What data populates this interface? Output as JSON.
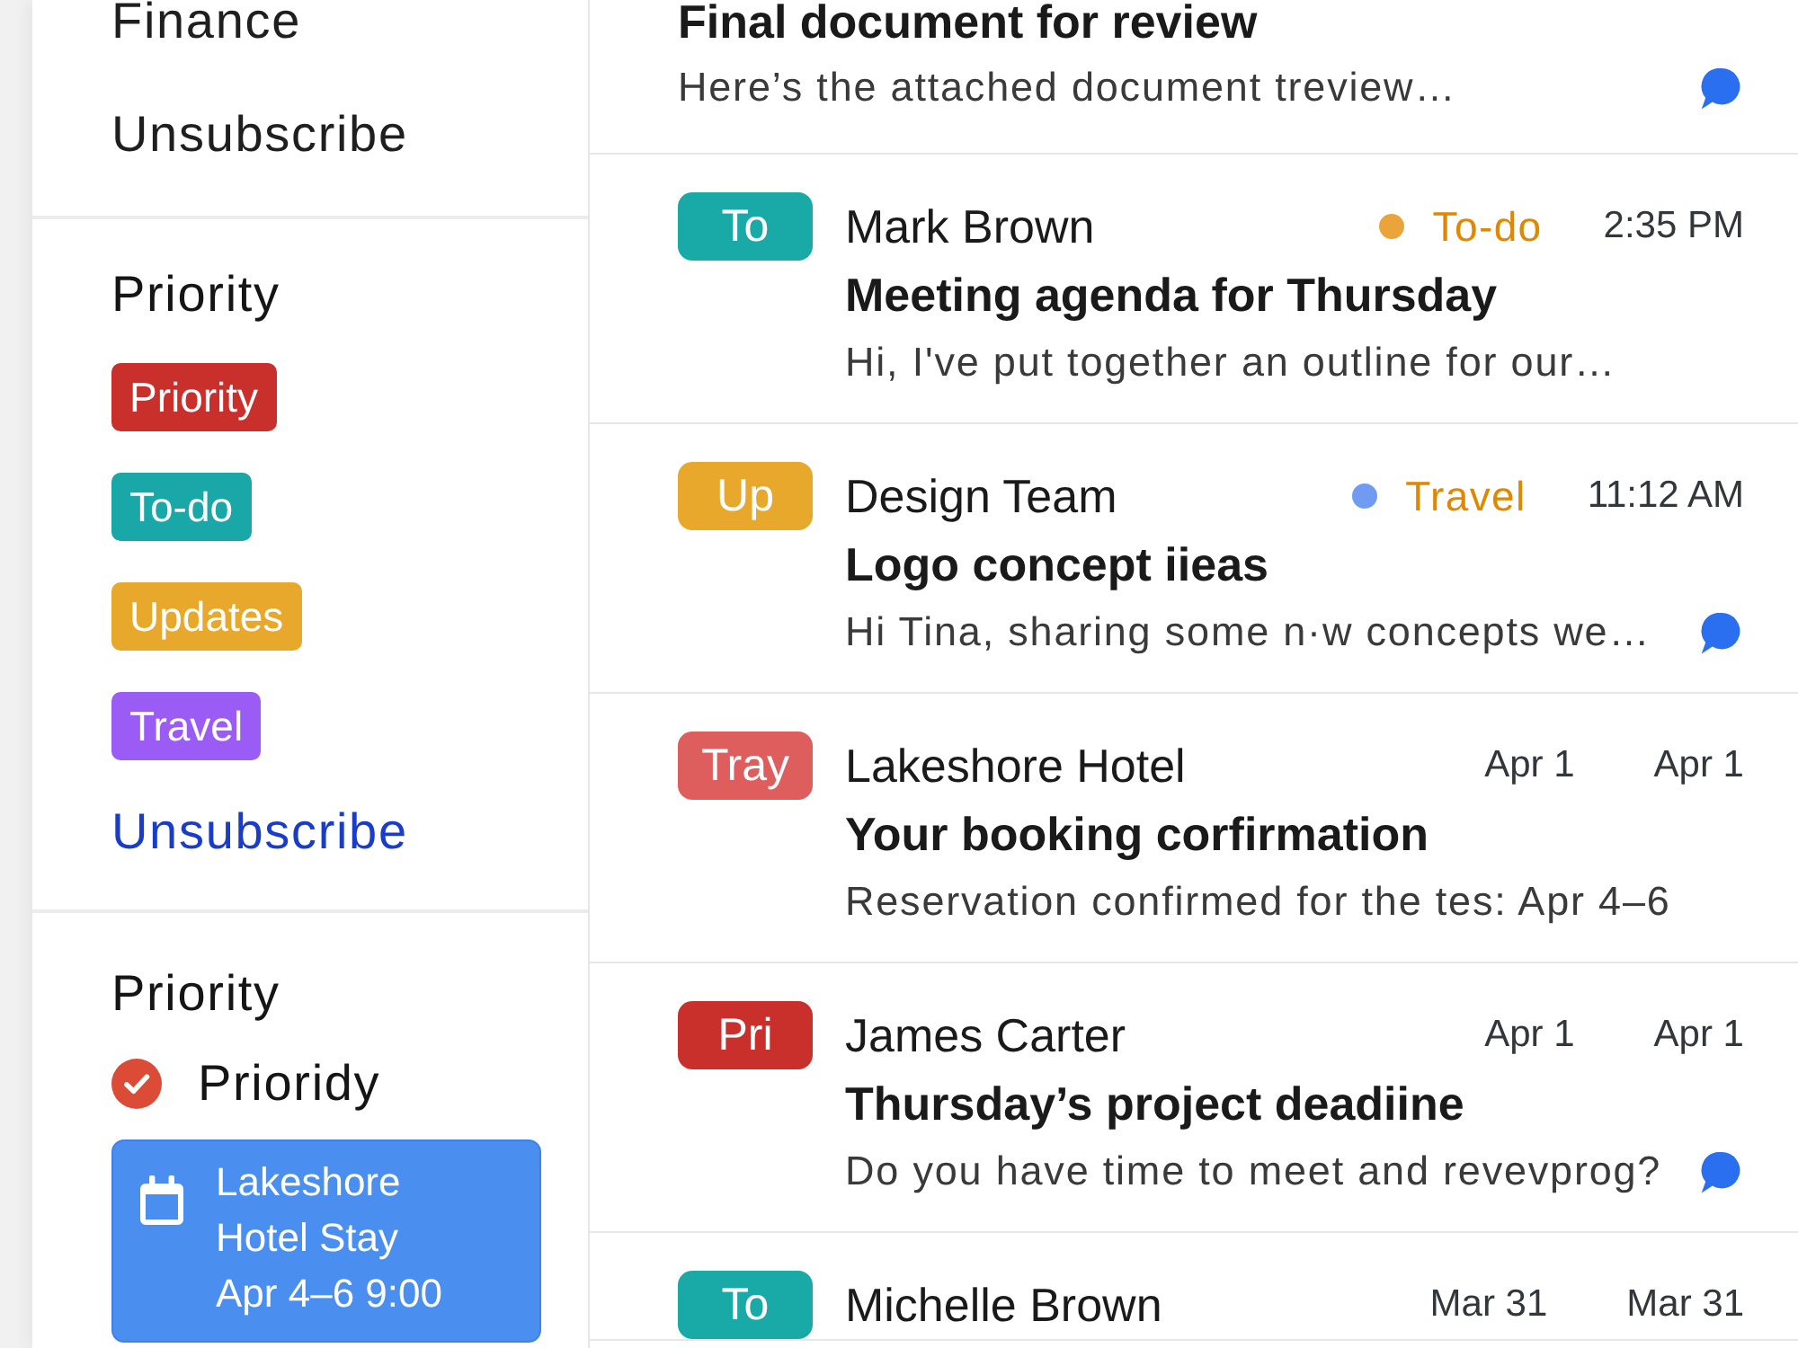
{
  "sidebar": {
    "folders": [
      {
        "label": "Finance"
      },
      {
        "label": "Unsubscribe"
      }
    ],
    "labels": {
      "title": "Priority",
      "tags": [
        {
          "label": "Priority",
          "color": "#c9302c"
        },
        {
          "label": "To-do",
          "color": "#19a7a8"
        },
        {
          "label": "Updates",
          "color": "#e8a82c"
        },
        {
          "label": "Travel",
          "color": "#9b5cf6"
        }
      ],
      "link": "Unsubscribe"
    },
    "tasks": {
      "title": "Priority",
      "task": {
        "label": "Prioridy",
        "checked": true
      },
      "event": {
        "title": "Lakeshore Hotel Stay",
        "when": "Apr 4–6 9:00"
      }
    }
  },
  "emails": [
    {
      "subject": "Final document for review",
      "preview": "Here’s the attached document treview…",
      "chat": true
    },
    {
      "avatar": {
        "text": "To",
        "color": "#19aaa8"
      },
      "sender": "Mark Brown",
      "label": {
        "text": "To-do",
        "color": "#eba43a"
      },
      "times": [
        "2:35 PM"
      ],
      "subject": "Meeting agenda for Thursday",
      "preview": "Hi, I've put together an outline for our…",
      "chat": false
    },
    {
      "avatar": {
        "text": "Up",
        "color": "#e8a82c"
      },
      "sender": "Design Team",
      "label": {
        "text": "Travel",
        "color": "#6f9cf2"
      },
      "times": [
        "11:12 AM"
      ],
      "subject": "Logo concept iieas",
      "preview": "Hi Tina, sharing some n·w concepts we…",
      "chat": true
    },
    {
      "avatar": {
        "text": "Tray",
        "color": "#de5d5d"
      },
      "sender": "Lakeshore Hotel",
      "times": [
        "Apr 1",
        "Apr 1"
      ],
      "subject": "Your booking corfirmation",
      "preview": "Reservation confirmed for the tes: Apr 4–6",
      "chat": false
    },
    {
      "avatar": {
        "text": "Pri",
        "color": "#c9302c"
      },
      "sender": "James Carter",
      "times": [
        "Apr 1",
        "Apr 1"
      ],
      "subject": "Thursday’s project deadiine",
      "preview": "Do you have time to meet and revevprog?",
      "chat": true
    },
    {
      "avatar": {
        "text": "To",
        "color": "#19aaa8"
      },
      "sender": "Michelle Brown",
      "times": [
        "Mar 31",
        "Mar 31"
      ]
    }
  ]
}
